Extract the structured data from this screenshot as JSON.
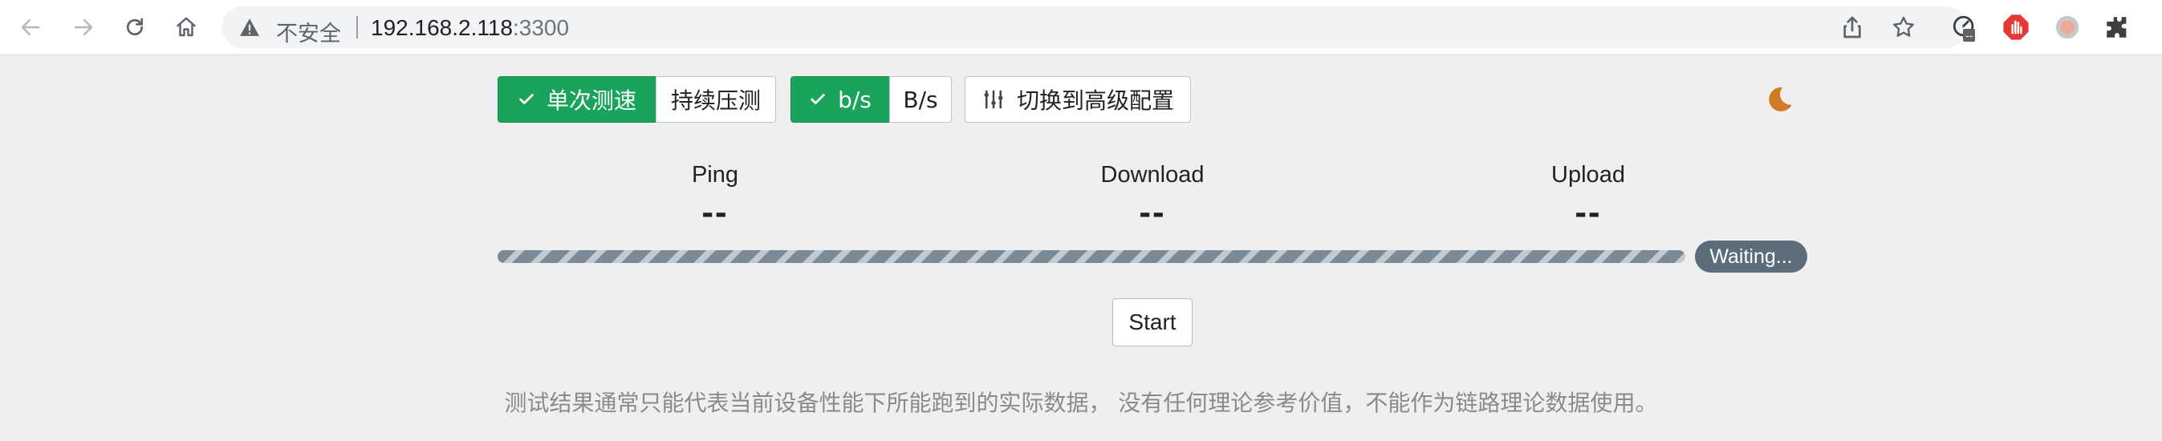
{
  "browser": {
    "security_label": "不安全",
    "url_host": "192.168.2.118",
    "url_port": ":3300",
    "extension_badge": "--"
  },
  "toolbar": {
    "mode_single": "单次测速",
    "mode_continuous": "持续压测",
    "unit_bits": "b/s",
    "unit_bytes": "B/s",
    "advanced_config": "切换到高级配置"
  },
  "stats": {
    "ping_label": "Ping",
    "ping_value": "--",
    "download_label": "Download",
    "download_value": "--",
    "upload_label": "Upload",
    "upload_value": "--"
  },
  "progress": {
    "status": "Waiting..."
  },
  "start_label": "Start",
  "disclaimer": "测试结果通常只能代表当前设备性能下所能跑到的实际数据， 没有任何理论参考价值，不能作为链路理论数据使用。",
  "colors": {
    "accent_green": "#1aa35a",
    "badge_gray": "#5b6c7b",
    "moon_orange": "#d07a28"
  },
  "icons": [
    "back-icon",
    "forward-icon",
    "reload-icon",
    "home-icon",
    "warning-icon",
    "share-icon",
    "star-icon",
    "speedometer-icon",
    "stop-hand-icon",
    "circle-icon",
    "puzzle-icon",
    "check-icon",
    "sliders-icon",
    "moon-icon"
  ]
}
